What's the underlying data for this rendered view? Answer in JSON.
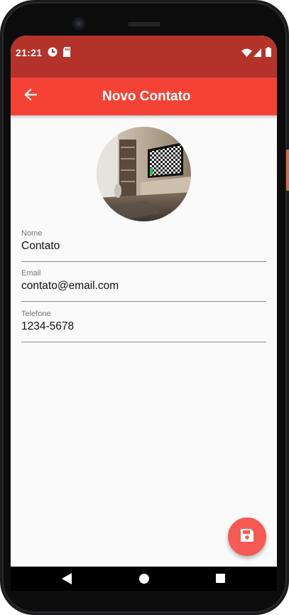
{
  "status_bar": {
    "time": "21:21",
    "left_icons": [
      "app-notification-icon",
      "sd-card-icon"
    ],
    "right_icons": [
      "wifi-icon",
      "signal-icon",
      "battery-icon"
    ]
  },
  "app_bar": {
    "title": "Novo Contato",
    "back_icon": "arrow-back-icon"
  },
  "avatar": {
    "description_icon": "contact-photo"
  },
  "form": {
    "fields": [
      {
        "label": "Nome",
        "value": "Contato"
      },
      {
        "label": "Email",
        "value": "contato@email.com"
      },
      {
        "label": "Telefone",
        "value": "1234-5678"
      }
    ]
  },
  "fab": {
    "icon": "save-icon"
  },
  "nav_bar": {
    "icons": [
      "back-triangle-icon",
      "home-circle-icon",
      "recents-square-icon"
    ]
  },
  "colors": {
    "status_bar": "#b3332b",
    "app_bar": "#f44336",
    "fab": "#f55a55",
    "background": "#fafafa"
  }
}
